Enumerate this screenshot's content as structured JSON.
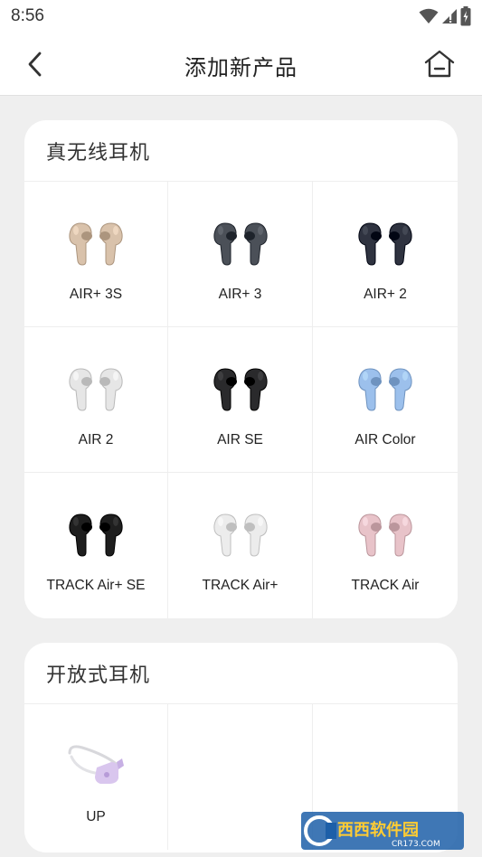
{
  "status_bar": {
    "time": "8:56",
    "icons": [
      "wifi-icon",
      "signal-icon",
      "battery-icon"
    ]
  },
  "app_bar": {
    "title": "添加新产品",
    "back_icon": "chevron-left-icon",
    "home_icon": "home-icon"
  },
  "sections": [
    {
      "title": "真无线耳机",
      "products": [
        {
          "label": "AIR+ 3S",
          "color": "#d9c2ab"
        },
        {
          "label": "AIR+ 3",
          "color": "#4b5058"
        },
        {
          "label": "AIR+ 2",
          "color": "#2f3340"
        },
        {
          "label": "AIR 2",
          "color": "#e6e6e6"
        },
        {
          "label": "AIR SE",
          "color": "#2a2a2c"
        },
        {
          "label": "AIR Color",
          "color": "#9cc0ec"
        },
        {
          "label": "TRACK Air+ SE",
          "color": "#1e1e1e"
        },
        {
          "label": "TRACK Air+",
          "color": "#ececec"
        },
        {
          "label": "TRACK Air",
          "color": "#e8c3c9"
        }
      ]
    },
    {
      "title": "开放式耳机",
      "products": [
        {
          "label": "UP",
          "color": "#d9c6ee"
        }
      ]
    }
  ],
  "watermark": {
    "text": "西西软件园",
    "subtext": "CR173.COM"
  }
}
